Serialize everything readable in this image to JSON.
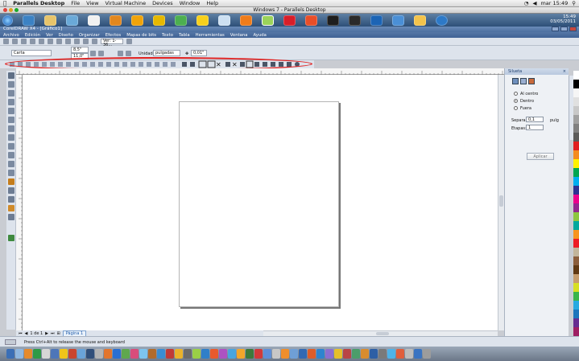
{
  "mac_menubar": {
    "app_name": "Parallels Desktop",
    "items": [
      "File",
      "View",
      "Virtual Machine",
      "Devices",
      "Window",
      "Help"
    ],
    "clock": "mar 15:49"
  },
  "vm_window": {
    "title": "Windows 7 - Parallels Desktop"
  },
  "win_taskbar": {
    "time": "15:49",
    "date": "03/05/2011"
  },
  "corel": {
    "title": "CorelDRAW X4 - [Gráfico1]",
    "menu": [
      "Archivo",
      "Edición",
      "Ver",
      "Diseño",
      "Organizar",
      "Efectos",
      "Mapas de bits",
      "Texto",
      "Tabla",
      "Herramientas",
      "Ventana",
      "Ayuda"
    ],
    "zoom": "Ver: 1-36...",
    "paper_size": "Carta",
    "width": "8,5\"",
    "height": "11,0\"",
    "units_label": "Unidades:",
    "units_value": "pulgadas",
    "nudge": "0,01\""
  },
  "docker": {
    "title": "Silueta",
    "options": [
      "Al centro",
      "Dentro",
      "Fuera"
    ],
    "selected_option": "Dentro",
    "offset_label": "Separar:",
    "offset_value": "0,1",
    "offset_unit": "pulg",
    "steps_label": "Etapas:",
    "steps_value": "1",
    "apply_label": "Aplicar"
  },
  "page_nav": {
    "current": "1 de 1",
    "page_tab": "Página 1"
  },
  "status": {
    "message": "Press Ctrl+Alt to release the mouse and keyboard"
  },
  "colors": {
    "highlight": "#e0201f",
    "palette": [
      "#ffffff",
      "#000000",
      "#f5f5f5",
      "#e0e0e0",
      "#c8c8c8",
      "#a0a0a0",
      "#808080",
      "#5a5a5a",
      "#e11e1e",
      "#f48b1f",
      "#fff200",
      "#00a651",
      "#00aeef",
      "#2e3192",
      "#ec008c",
      "#92278f",
      "#8dc63f",
      "#00a99d",
      "#f7941d",
      "#ed1c24",
      "#c2b59b",
      "#8b5e3c",
      "#603913",
      "#c69c6d",
      "#d7df23",
      "#39b54a",
      "#27aae1",
      "#1c75bc",
      "#662d91",
      "#9e1f63"
    ]
  }
}
